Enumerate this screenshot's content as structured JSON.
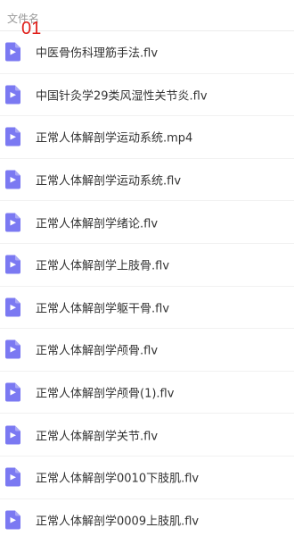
{
  "header": {
    "column_label": "文件名",
    "overlay_label": "01"
  },
  "colors": {
    "video_icon": "#7b79f2",
    "overlay_red": "#e0201b"
  },
  "files": [
    {
      "name": "中医骨伤科理筋手法.flv",
      "icon": "video-file-icon"
    },
    {
      "name": "中国针灸学29类风湿性关节炎.flv",
      "icon": "video-file-icon"
    },
    {
      "name": "正常人体解剖学运动系统.mp4",
      "icon": "video-file-icon"
    },
    {
      "name": "正常人体解剖学运动系统.flv",
      "icon": "video-file-icon"
    },
    {
      "name": "正常人体解剖学绪论.flv",
      "icon": "video-file-icon"
    },
    {
      "name": "正常人体解剖学上肢骨.flv",
      "icon": "video-file-icon"
    },
    {
      "name": "正常人体解剖学躯干骨.flv",
      "icon": "video-file-icon"
    },
    {
      "name": "正常人体解剖学颅骨.flv",
      "icon": "video-file-icon"
    },
    {
      "name": "正常人体解剖学颅骨(1).flv",
      "icon": "video-file-icon"
    },
    {
      "name": "正常人体解剖学关节.flv",
      "icon": "video-file-icon"
    },
    {
      "name": "正常人体解剖学0010下肢肌.flv",
      "icon": "video-file-icon"
    },
    {
      "name": "正常人体解剖学0009上肢肌.flv",
      "icon": "video-file-icon"
    }
  ]
}
